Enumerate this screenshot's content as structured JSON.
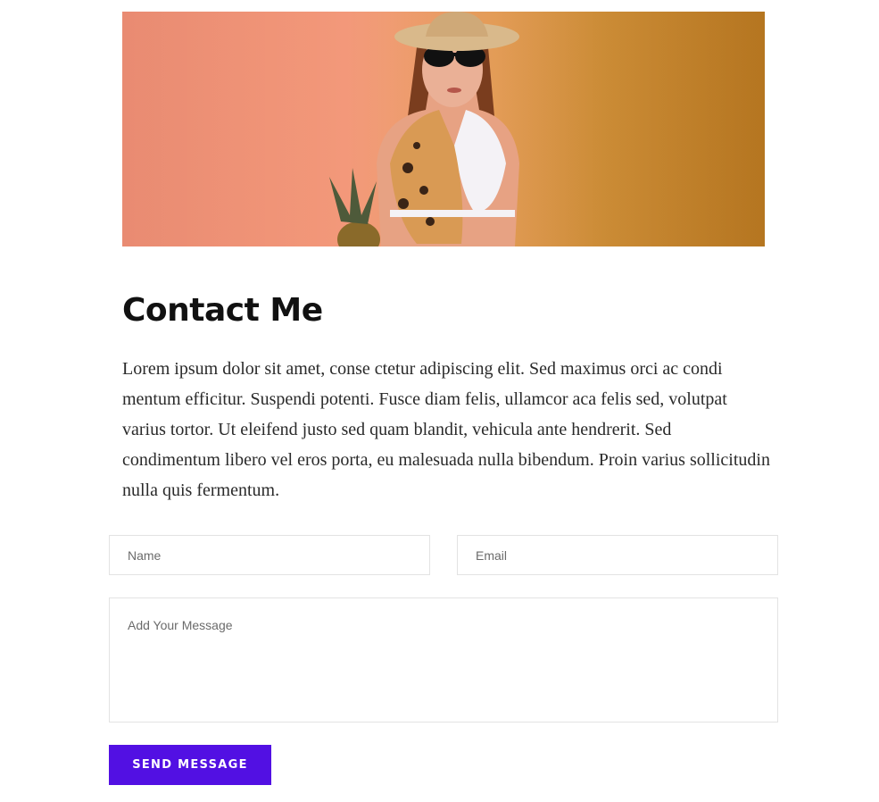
{
  "hero": {
    "image_name": "woman-in-swimsuit-with-pineapple-photo"
  },
  "contact": {
    "title": "Contact Me",
    "intro": "Lorem ipsum dolor sit amet, conse ctetur adipiscing elit. Sed maximus orci ac condi mentum efficitur. Suspendi potenti. Fusce diam felis, ullamcor aca felis sed, volutpat varius tortor. Ut eleifend justo sed quam blandit, vehicula ante hendrerit. Sed condimentum libero vel eros porta, eu malesuada nulla bibendum. Proin varius sollicitudin nulla quis fermentum."
  },
  "form": {
    "name_placeholder": "Name",
    "name_value": "",
    "email_placeholder": "Email",
    "email_value": "",
    "message_placeholder": "Add Your Message",
    "message_value": "",
    "submit_label": "SEND MESSAGE"
  },
  "colors": {
    "accent": "#5210e3",
    "heading": "#111111",
    "body_text": "#2a2a2a",
    "field_border": "#e3e3e3"
  }
}
